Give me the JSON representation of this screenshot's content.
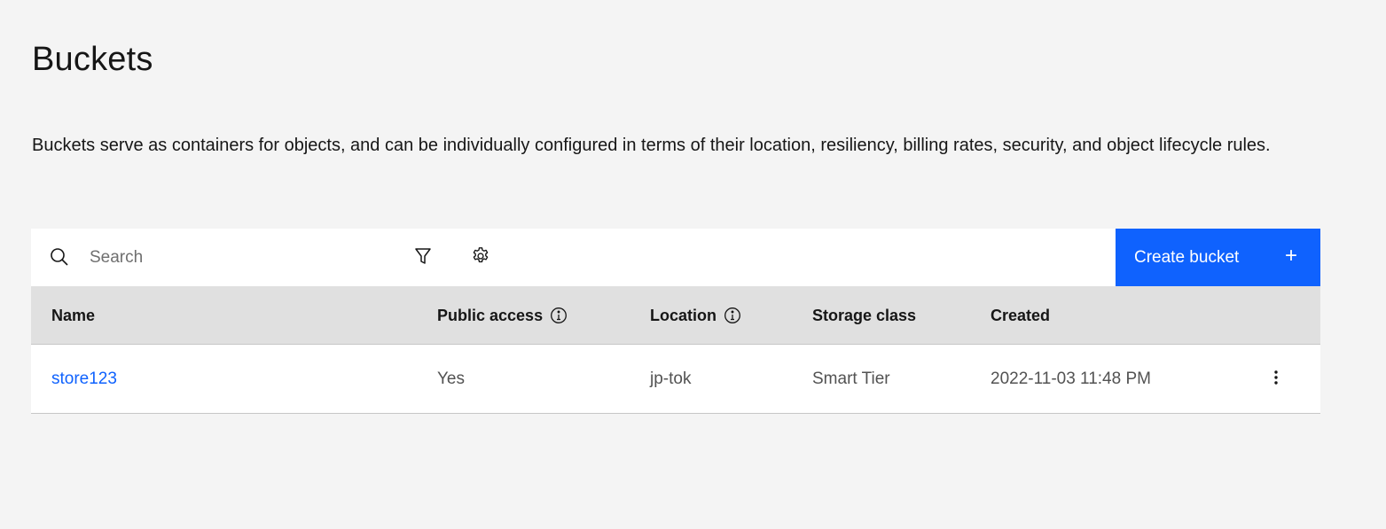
{
  "page": {
    "title": "Buckets",
    "description": "Buckets serve as containers for objects, and can be individually configured in terms of their location, resiliency, billing rates, security, and object lifecycle rules."
  },
  "toolbar": {
    "search_placeholder": "Search",
    "search_icon": "search-icon",
    "filter_icon": "filter-icon",
    "settings_icon": "gear-icon",
    "create_label": "Create bucket",
    "create_icon": "+"
  },
  "table": {
    "headers": {
      "name": "Name",
      "public_access": "Public access",
      "location": "Location",
      "storage_class": "Storage class",
      "created": "Created"
    },
    "rows": [
      {
        "name": "store123",
        "public_access": "Yes",
        "location": "jp-tok",
        "storage_class": "Smart Tier",
        "created": "2022-11-03 11:48 PM"
      }
    ]
  },
  "colors": {
    "background": "#f4f4f4",
    "primary": "#0f62fe",
    "header_bg": "#e0e0e0",
    "link": "#0f62fe"
  }
}
